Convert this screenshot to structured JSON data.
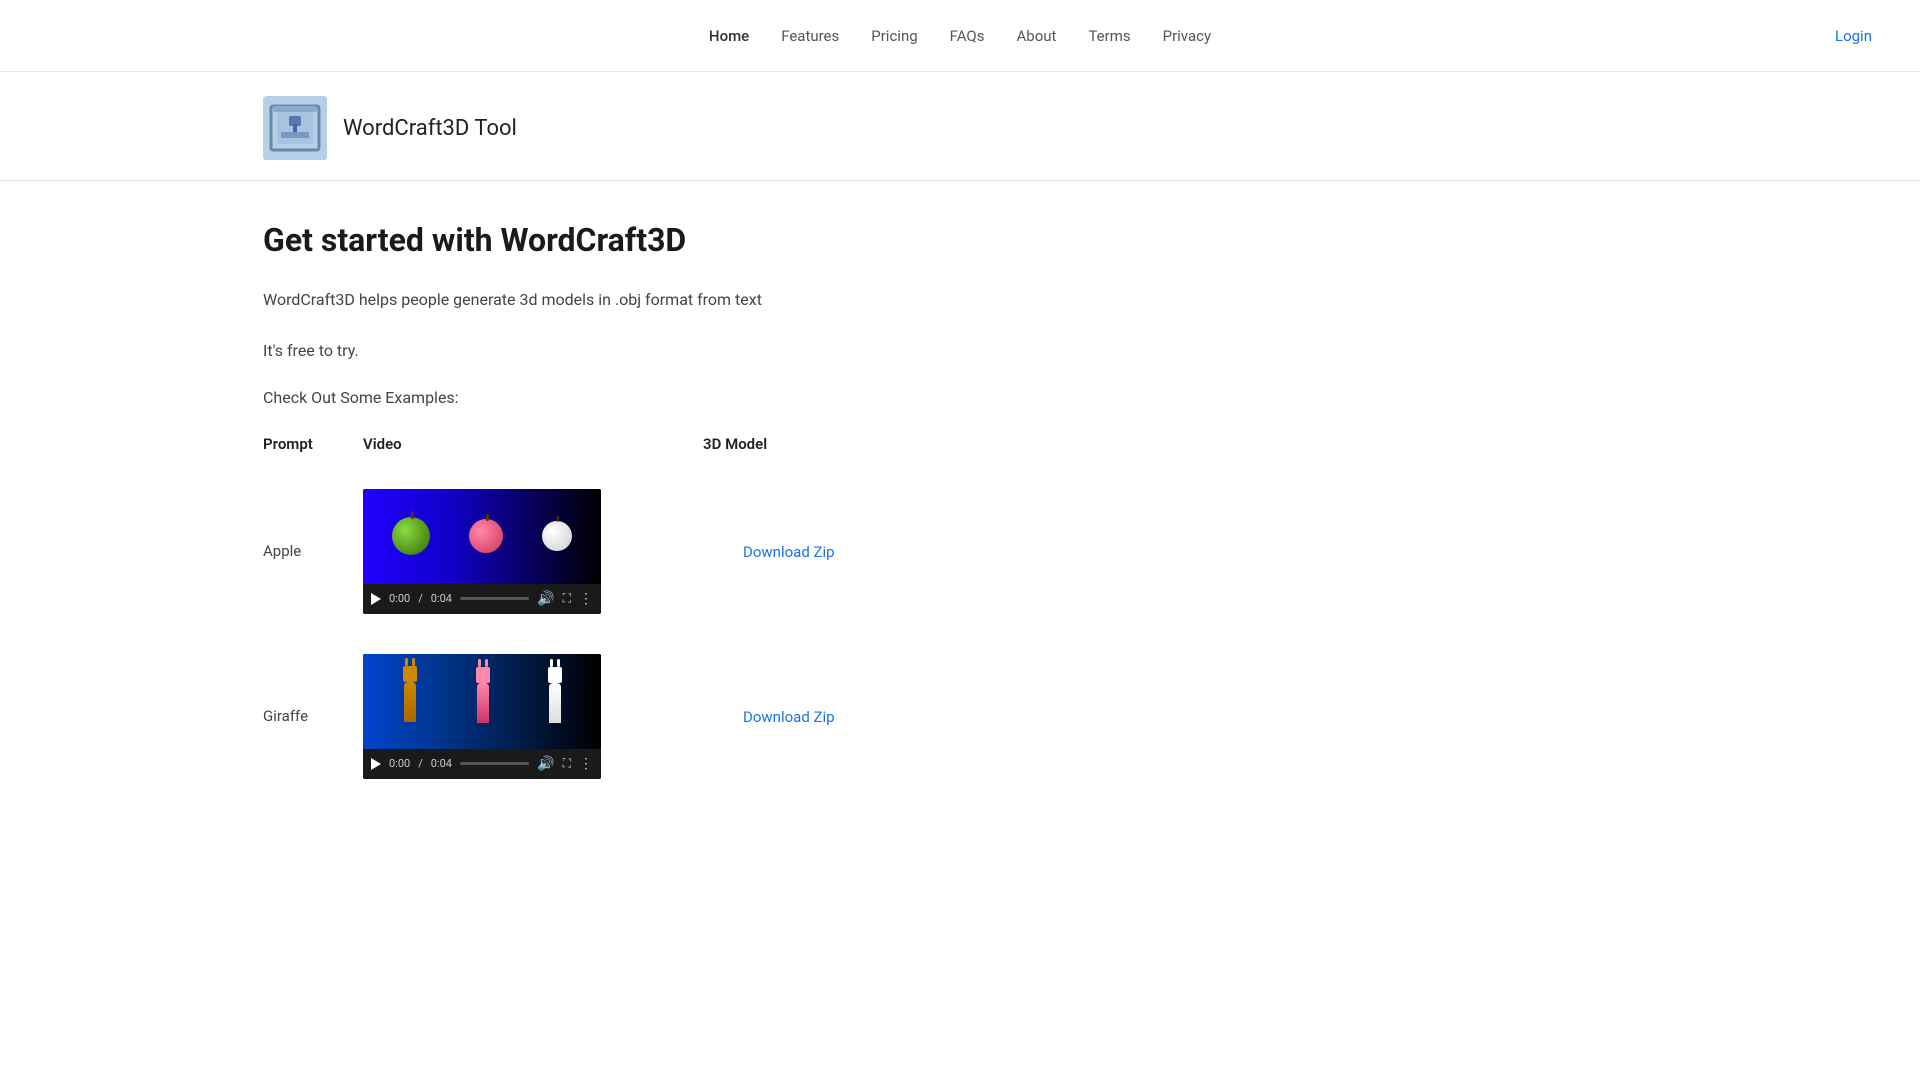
{
  "nav": {
    "links": [
      {
        "label": "Home",
        "id": "home",
        "active": true
      },
      {
        "label": "Features",
        "id": "features",
        "active": false
      },
      {
        "label": "Pricing",
        "id": "pricing",
        "active": false
      },
      {
        "label": "FAQs",
        "id": "faqs",
        "active": false
      },
      {
        "label": "About",
        "id": "about",
        "active": false
      },
      {
        "label": "Terms",
        "id": "terms",
        "active": false
      },
      {
        "label": "Privacy",
        "id": "privacy",
        "active": false
      }
    ],
    "login_label": "Login"
  },
  "brand": {
    "title": "WordCraft3D Tool"
  },
  "hero": {
    "heading": "Get started with WordCraft3D",
    "description": "WordCraft3D helps people generate 3d models in .obj format from text",
    "free_text": "It's free to try.",
    "examples_label": "Check Out Some Examples:"
  },
  "table": {
    "col_prompt": "Prompt",
    "col_video": "Video",
    "col_model": "3D Model",
    "rows": [
      {
        "prompt": "Apple",
        "video_type": "apple",
        "time_current": "0:00",
        "time_total": "0:04",
        "download_label": "Download Zip"
      },
      {
        "prompt": "Giraffe",
        "video_type": "giraffe",
        "time_current": "0:00",
        "time_total": "0:04",
        "download_label": "Download Zip"
      }
    ]
  }
}
